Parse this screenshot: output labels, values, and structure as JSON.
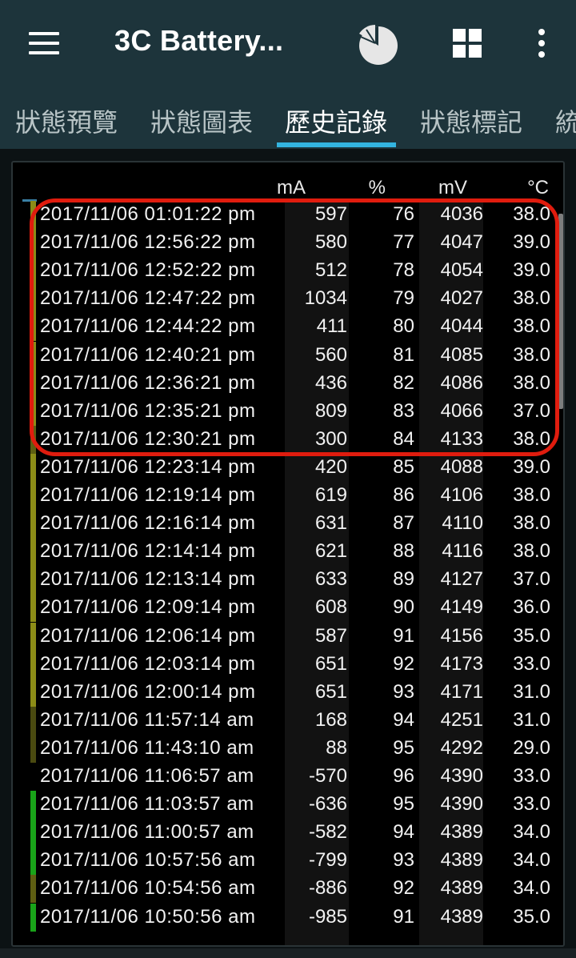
{
  "app": {
    "title": "3C Battery..."
  },
  "icons": {
    "menu": "hamburger-menu-icon",
    "chart": "pie-chart-icon",
    "grid": "grid-view-icon",
    "more": "more-vert-icon"
  },
  "tabs": [
    {
      "label": "狀態預覽"
    },
    {
      "label": "狀態圖表"
    },
    {
      "label": "歷史記錄"
    },
    {
      "label": "狀態標記"
    },
    {
      "label": "統"
    }
  ],
  "active_tab": 2,
  "colors": {
    "accent": "#33b4e0",
    "highlight": "#e01c0e",
    "appbar": "#1d343b"
  },
  "table": {
    "headers": {
      "ma": "mA",
      "pct": "%",
      "mv": "mV",
      "temp": "°C"
    },
    "rows": [
      {
        "time": "2017/11/06 01:01:22 pm",
        "ma": "597",
        "pct": "76",
        "mv": "4036",
        "temp": "38.0",
        "bar": "#8c8c17"
      },
      {
        "time": "2017/11/06 12:56:22 pm",
        "ma": "580",
        "pct": "77",
        "mv": "4047",
        "temp": "39.0",
        "bar": "#8c8c17"
      },
      {
        "time": "2017/11/06 12:52:22 pm",
        "ma": "512",
        "pct": "78",
        "mv": "4054",
        "temp": "39.0",
        "bar": "#8c8c17"
      },
      {
        "time": "2017/11/06 12:47:22 pm",
        "ma": "1034",
        "pct": "79",
        "mv": "4027",
        "temp": "38.0",
        "bar": "#8c8c17"
      },
      {
        "time": "2017/11/06 12:44:22 pm",
        "ma": "411",
        "pct": "80",
        "mv": "4044",
        "temp": "38.0",
        "bar": "#8c8c17"
      },
      {
        "time": "2017/11/06 12:40:21 pm",
        "ma": "560",
        "pct": "81",
        "mv": "4085",
        "temp": "38.0",
        "bar": "#8c8c17"
      },
      {
        "time": "2017/11/06 12:36:21 pm",
        "ma": "436",
        "pct": "82",
        "mv": "4086",
        "temp": "38.0",
        "bar": "#8c8c17"
      },
      {
        "time": "2017/11/06 12:35:21 pm",
        "ma": "809",
        "pct": "83",
        "mv": "4066",
        "temp": "37.0",
        "bar": "#8c8c17"
      },
      {
        "time": "2017/11/06 12:30:21 pm",
        "ma": "300",
        "pct": "84",
        "mv": "4133",
        "temp": "38.0",
        "bar": "#5e5e12"
      },
      {
        "time": "2017/11/06 12:23:14 pm",
        "ma": "420",
        "pct": "85",
        "mv": "4088",
        "temp": "39.0",
        "bar": "#8c8c17"
      },
      {
        "time": "2017/11/06 12:19:14 pm",
        "ma": "619",
        "pct": "86",
        "mv": "4106",
        "temp": "38.0",
        "bar": "#8c8c17"
      },
      {
        "time": "2017/11/06 12:16:14 pm",
        "ma": "631",
        "pct": "87",
        "mv": "4110",
        "temp": "38.0",
        "bar": "#8c8c17"
      },
      {
        "time": "2017/11/06 12:14:14 pm",
        "ma": "621",
        "pct": "88",
        "mv": "4116",
        "temp": "38.0",
        "bar": "#8c8c17"
      },
      {
        "time": "2017/11/06 12:13:14 pm",
        "ma": "633",
        "pct": "89",
        "mv": "4127",
        "temp": "37.0",
        "bar": "#8c8c17"
      },
      {
        "time": "2017/11/06 12:09:14 pm",
        "ma": "608",
        "pct": "90",
        "mv": "4149",
        "temp": "36.0",
        "bar": "#8c8c17"
      },
      {
        "time": "2017/11/06 12:06:14 pm",
        "ma": "587",
        "pct": "91",
        "mv": "4156",
        "temp": "35.0",
        "bar": "#8c8c17"
      },
      {
        "time": "2017/11/06 12:03:14 pm",
        "ma": "651",
        "pct": "92",
        "mv": "4173",
        "temp": "33.0",
        "bar": "#8c8c17"
      },
      {
        "time": "2017/11/06 12:00:14 pm",
        "ma": "651",
        "pct": "93",
        "mv": "4171",
        "temp": "31.0",
        "bar": "#8c8c17"
      },
      {
        "time": "2017/11/06 11:57:14 am",
        "ma": "168",
        "pct": "94",
        "mv": "4251",
        "temp": "31.0",
        "bar": "#4a4a10"
      },
      {
        "time": "2017/11/06 11:43:10 am",
        "ma": "88",
        "pct": "95",
        "mv": "4292",
        "temp": "29.0",
        "bar": "#4a4a10"
      },
      {
        "time": "2017/11/06 11:06:57 am",
        "ma": "-570",
        "pct": "96",
        "mv": "4390",
        "temp": "33.0",
        "bar": ""
      },
      {
        "time": "2017/11/06 11:03:57 am",
        "ma": "-636",
        "pct": "95",
        "mv": "4390",
        "temp": "33.0",
        "bar": "#19a319"
      },
      {
        "time": "2017/11/06 11:00:57 am",
        "ma": "-582",
        "pct": "94",
        "mv": "4389",
        "temp": "34.0",
        "bar": "#19a319"
      },
      {
        "time": "2017/11/06 10:57:56 am",
        "ma": "-799",
        "pct": "93",
        "mv": "4389",
        "temp": "34.0",
        "bar": "#19a319"
      },
      {
        "time": "2017/11/06 10:54:56 am",
        "ma": "-886",
        "pct": "92",
        "mv": "4389",
        "temp": "34.0",
        "bar": "#5e5e12"
      },
      {
        "time": "2017/11/06 10:50:56 am",
        "ma": "-985",
        "pct": "91",
        "mv": "4389",
        "temp": "35.0",
        "bar": "#19a319"
      }
    ]
  }
}
